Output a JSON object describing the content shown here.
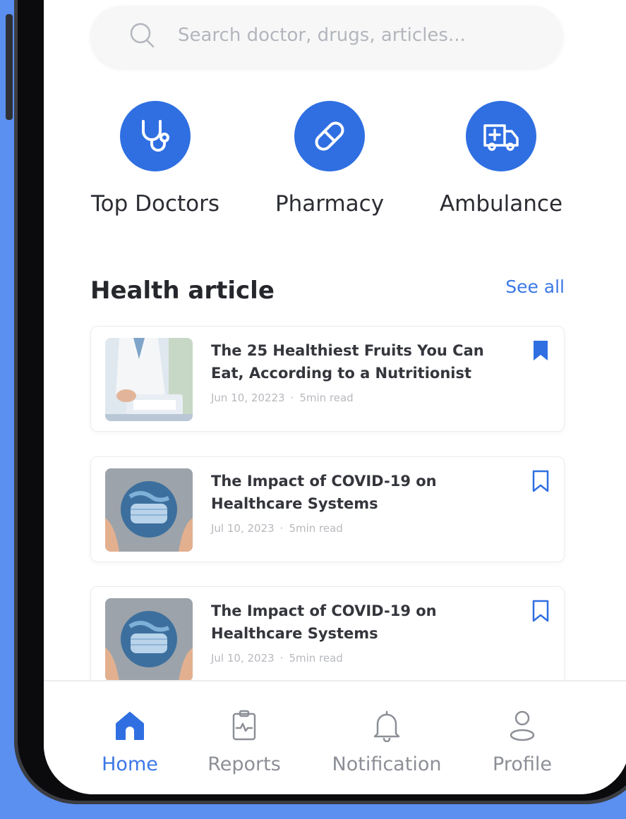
{
  "search": {
    "placeholder": "Search doctor, drugs, articles..."
  },
  "categories": [
    {
      "label": "Top Doctors",
      "icon": "stethoscope-icon"
    },
    {
      "label": "Pharmacy",
      "icon": "pill-icon"
    },
    {
      "label": "Ambulance",
      "icon": "ambulance-icon"
    }
  ],
  "section": {
    "title": "Health article",
    "see_all": "See all"
  },
  "articles": [
    {
      "title_line1": "The 25 Healthiest Fruits You Can",
      "title_line2": "Eat, According to a Nutritionist",
      "date": "Jun 10, 20223",
      "read": "5min read",
      "bookmarked": true
    },
    {
      "title_line1": "The Impact of COVID-19 on",
      "title_line2": "Healthcare Systems",
      "date": "Jul 10, 2023",
      "read": "5min read",
      "bookmarked": false
    },
    {
      "title_line1": "The Impact of COVID-19 on",
      "title_line2": "Healthcare Systems",
      "date": "Jul 10, 2023",
      "read": "5min read",
      "bookmarked": false
    }
  ],
  "nav": {
    "items": [
      {
        "label": "Home",
        "active": true
      },
      {
        "label": "Reports",
        "active": false
      },
      {
        "label": "Notification",
        "active": false
      },
      {
        "label": "Profile",
        "active": false
      }
    ]
  },
  "colors": {
    "accent": "#2f6fe2",
    "link": "#3b78e6",
    "background": "#5b8ff0"
  }
}
